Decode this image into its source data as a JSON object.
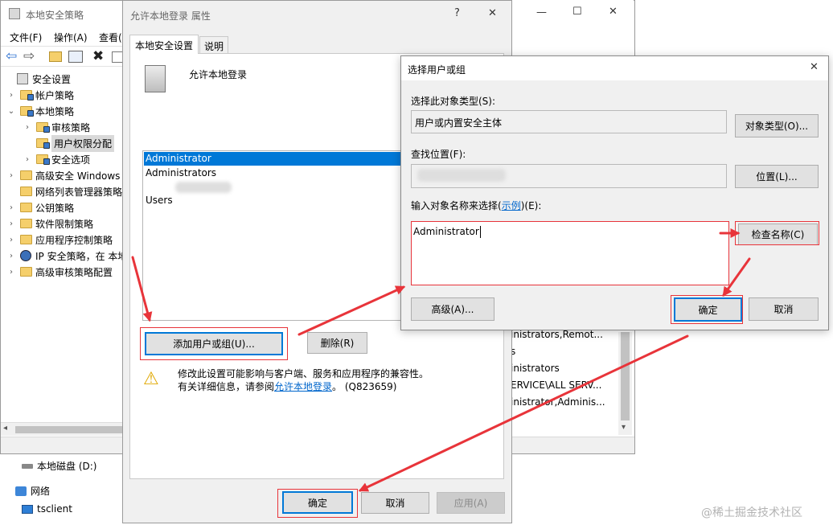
{
  "mmc": {
    "title": "本地安全策略",
    "menu": [
      "文件(F)",
      "操作(A)",
      "查看("
    ],
    "tree": [
      {
        "label": "安全设置",
        "level": 0,
        "exp": ""
      },
      {
        "label": "帐户策略",
        "level": 1,
        "exp": "›"
      },
      {
        "label": "本地策略",
        "level": 1,
        "exp": "⌄"
      },
      {
        "label": "审核策略",
        "level": 2,
        "exp": "›"
      },
      {
        "label": "用户权限分配",
        "level": 2,
        "exp": "",
        "selected": true
      },
      {
        "label": "安全选项",
        "level": 2,
        "exp": "›"
      },
      {
        "label": "高级安全 Windows",
        "level": 1,
        "exp": "›"
      },
      {
        "label": "网络列表管理器策略",
        "level": 1,
        "exp": ""
      },
      {
        "label": "公钥策略",
        "level": 1,
        "exp": "›"
      },
      {
        "label": "软件限制策略",
        "level": 1,
        "exp": "›"
      },
      {
        "label": "应用程序控制策略",
        "level": 1,
        "exp": "›"
      },
      {
        "label": "IP 安全策略，在 本地",
        "level": 1,
        "exp": "›"
      },
      {
        "label": "高级审核策略配置",
        "level": 1,
        "exp": "›"
      }
    ],
    "right_rows": [
      "inistrators,Remot...",
      "s",
      "inistrators",
      "ERVICE\\ALL SERV...",
      "inistrator,Adminis..."
    ]
  },
  "explorer": {
    "items": [
      "本地磁盘 (D:)",
      "网络",
      "tsclient"
    ]
  },
  "props": {
    "title": "允许本地登录 属性",
    "help": "?",
    "close": "✕",
    "tabs": [
      "本地安全设置",
      "说明"
    ],
    "policy_name": "允许本地登录",
    "list": [
      "Administrator",
      "Administrators",
      "Users"
    ],
    "add_button": "添加用户或组(U)...",
    "remove_button": "删除(R)",
    "warning_line1": "修改此设置可能影响与客户端、服务和应用程序的兼容性。",
    "warning_pre": "有关详细信息，请参阅",
    "warning_link": "允许本地登录",
    "warning_post": "。 (Q823659)",
    "ok": "确定",
    "cancel": "取消",
    "apply": "应用(A)"
  },
  "bg_window": {
    "minimize": "—",
    "maximize": "☐",
    "close": "✕"
  },
  "select_dialog": {
    "title": "选择用户或组",
    "close": "✕",
    "object_type_label": "选择此对象类型(S):",
    "object_type_value": "用户或内置安全主体",
    "object_type_button": "对象类型(O)...",
    "location_label": "查找位置(F):",
    "location_button": "位置(L)...",
    "enter_label_pre": "输入对象名称来选择(",
    "enter_label_link": "示例",
    "enter_label_post": ")(E):",
    "enter_value": "Administrator",
    "check_names": "检查名称(C)",
    "advanced": "高级(A)...",
    "ok": "确定",
    "cancel": "取消"
  },
  "watermark": "@稀土掘金技术社区",
  "colors": {
    "selection": "#0078d7",
    "annotation_red": "#e8343a",
    "link": "#0066cc",
    "dialog_bg": "#f0f0f0"
  }
}
